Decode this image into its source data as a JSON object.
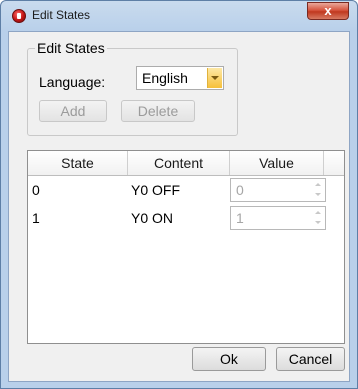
{
  "window": {
    "title": "Edit States",
    "close_symbol": "x",
    "icon": "app-icon"
  },
  "edit_group": {
    "legend": "Edit States",
    "language_label": "Language:",
    "language_value": "English",
    "add_label": "Add",
    "delete_label": "Delete"
  },
  "table": {
    "columns": [
      "State",
      "Content",
      "Value"
    ],
    "rows": [
      {
        "state": "0",
        "content": "Y0 OFF",
        "value": "0"
      },
      {
        "state": "1",
        "content": "Y0 ON",
        "value": "1"
      }
    ]
  },
  "footer": {
    "ok_label": "Ok",
    "cancel_label": "Cancel"
  },
  "colors": {
    "frame": "#b9d0ea",
    "close_button": "#c0381f",
    "dropdown_arrow": "#f6c03a"
  }
}
